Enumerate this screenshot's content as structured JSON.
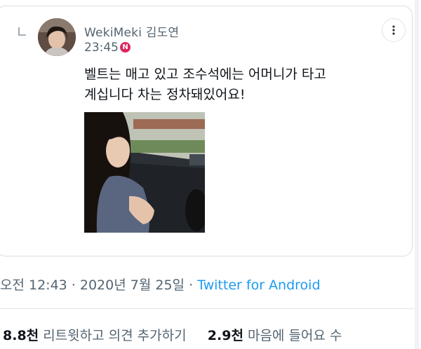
{
  "tweet": {
    "display_name": "WekiMeki 김도연",
    "time": "23:45",
    "badge": "N",
    "text_lines": [
      "벨트는 매고 있고 조수석에는 어머니가 타고",
      "계십니다 차는 정차돼있어요!"
    ]
  },
  "meta": {
    "timestamp": "오전 12:43 · 2020년 7월 25일",
    "separator": "·",
    "source": "Twitter for Android"
  },
  "stats": {
    "retweets_count": "8.8천",
    "retweets_label": "리트윗하고 의견 추가하기",
    "likes_count": "2.9천",
    "likes_label": "마음에 들어요 수"
  },
  "colors": {
    "secondary_text": "#536471",
    "link": "#1d9bf0",
    "badge": "#e0245e",
    "border": "#d9dde1"
  },
  "icons": {
    "reply": "reply-corner-icon",
    "more": "more-vertical-icon"
  }
}
